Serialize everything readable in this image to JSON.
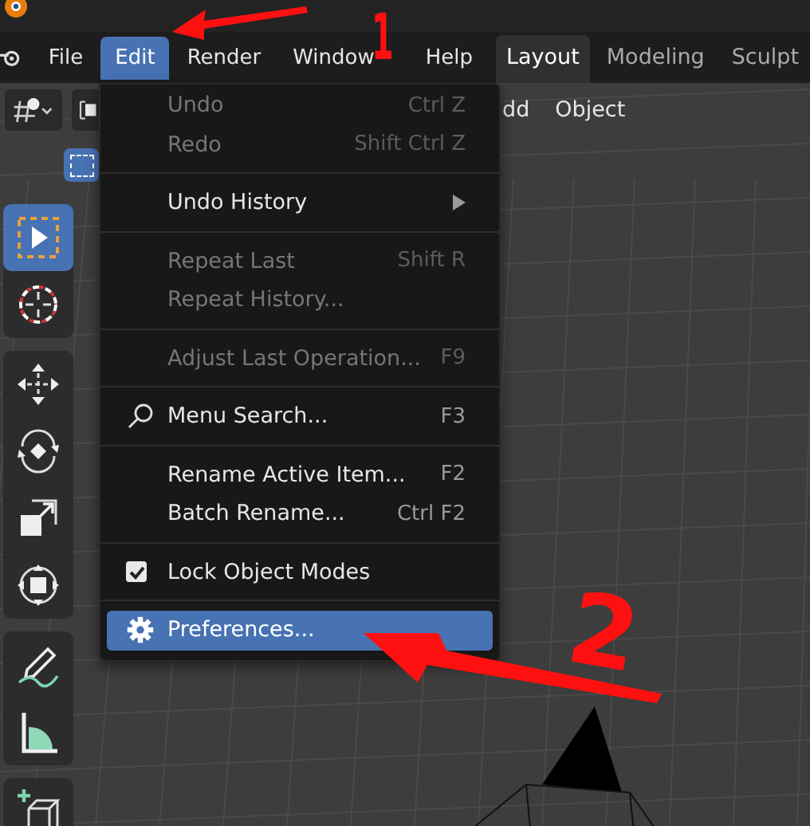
{
  "menubar": {
    "items": [
      {
        "label": "File",
        "selected": false
      },
      {
        "label": "Edit",
        "selected": true
      },
      {
        "label": "Render",
        "selected": false
      },
      {
        "label": "Window",
        "selected": false
      },
      {
        "label": "Help",
        "selected": false
      }
    ],
    "workspaces": [
      {
        "label": "Layout",
        "selected": true
      },
      {
        "label": "Modeling",
        "selected": false
      },
      {
        "label": "Sculpt",
        "selected": false
      }
    ]
  },
  "header": {
    "menus": [
      "dd",
      "Object"
    ]
  },
  "tool_groups": [
    {
      "tools": [
        {
          "kind": "select",
          "selected": true
        },
        {
          "kind": "cursor",
          "selected": false
        }
      ]
    },
    {
      "tools": [
        {
          "kind": "move",
          "selected": false
        },
        {
          "kind": "rotate",
          "selected": false
        },
        {
          "kind": "scale",
          "selected": false
        },
        {
          "kind": "transform",
          "selected": false
        }
      ]
    },
    {
      "tools": [
        {
          "kind": "annotate",
          "selected": false
        },
        {
          "kind": "measure",
          "selected": false
        }
      ]
    },
    {
      "tools": [
        {
          "kind": "add-cube",
          "selected": false
        }
      ]
    }
  ],
  "edit_menu": {
    "items": [
      {
        "kind": "item",
        "label": "Undo",
        "shortcut": "Ctrl Z",
        "disabled": true,
        "selected": false
      },
      {
        "kind": "item",
        "label": "Redo",
        "shortcut": "Shift Ctrl Z",
        "disabled": true,
        "selected": false
      },
      {
        "kind": "separator"
      },
      {
        "kind": "submenu",
        "label": "Undo History",
        "disabled": false,
        "selected": false
      },
      {
        "kind": "separator"
      },
      {
        "kind": "item",
        "label": "Repeat Last",
        "shortcut": "Shift R",
        "disabled": true,
        "selected": false
      },
      {
        "kind": "item",
        "label": "Repeat History...",
        "disabled": true,
        "selected": false
      },
      {
        "kind": "separator"
      },
      {
        "kind": "item",
        "label": "Adjust Last Operation...",
        "shortcut": "F9",
        "disabled": true,
        "selected": false
      },
      {
        "kind": "separator"
      },
      {
        "kind": "search",
        "label": "Menu Search...",
        "shortcut": "F3",
        "disabled": false,
        "selected": false
      },
      {
        "kind": "separator"
      },
      {
        "kind": "item",
        "label": "Rename Active Item...",
        "shortcut": "F2",
        "disabled": false,
        "selected": false
      },
      {
        "kind": "item",
        "label": "Batch Rename...",
        "shortcut": "Ctrl F2",
        "disabled": false,
        "selected": false
      },
      {
        "kind": "separator"
      },
      {
        "kind": "checkbox",
        "label": "Lock Object Modes",
        "checked": true,
        "disabled": false,
        "selected": false
      },
      {
        "kind": "separator"
      },
      {
        "kind": "settings",
        "label": "Preferences...",
        "disabled": false,
        "selected": true
      }
    ]
  },
  "annotations": [
    {
      "label": "1"
    },
    {
      "label": "2"
    }
  ]
}
